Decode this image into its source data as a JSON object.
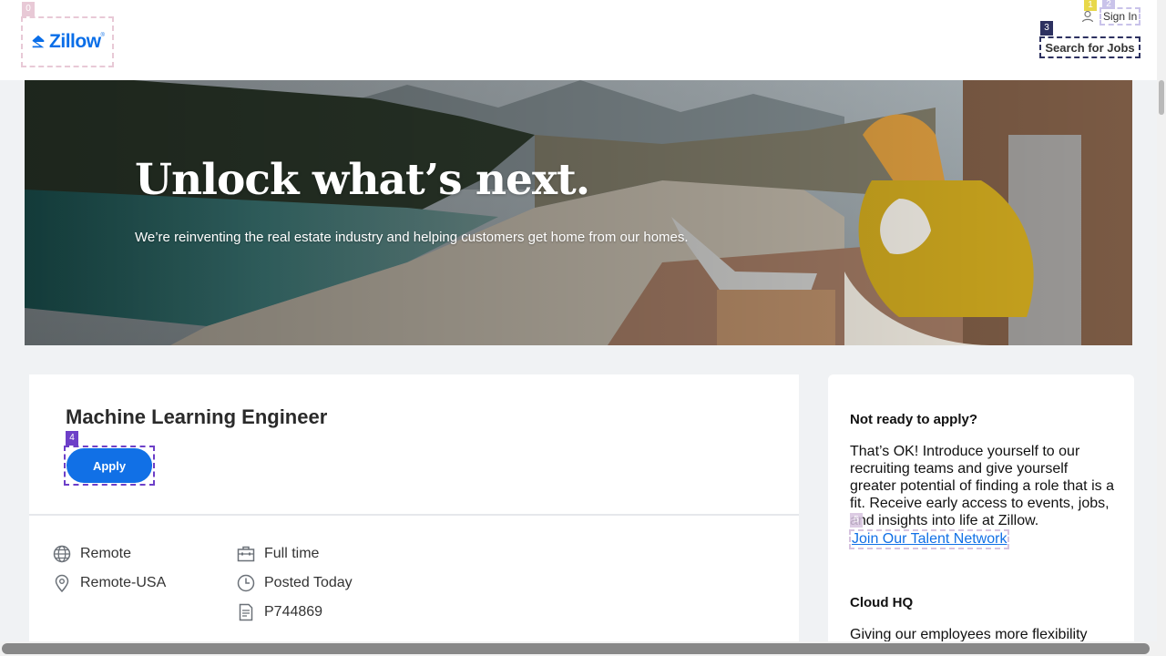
{
  "header": {
    "logo_text": "Zillow",
    "logo_reg": "®",
    "sign_in": "Sign In",
    "search_jobs": "Search for Jobs"
  },
  "tags": [
    "0",
    "1",
    "2",
    "3",
    "4",
    "5"
  ],
  "hero": {
    "title": "Unlock what’s next.",
    "subtitle": "We’re reinventing the real estate industry and helping customers get home from our homes."
  },
  "job": {
    "title": "Machine Learning Engineer",
    "apply_label": "Apply",
    "location_type": "Remote",
    "location": "Remote-USA",
    "employment_type": "Full time",
    "posted": "Posted Today",
    "req_id": "P744869"
  },
  "side": {
    "heading1": "Not ready to apply?",
    "body1": "That’s OK! Introduce yourself to our recruiting teams and give yourself greater potential of finding a role that is a fit. Receive early access to events, jobs, and insights into life at Zillow.",
    "talent_link": "Join Our Talent Network",
    "heading2": "Cloud HQ",
    "body2": "Giving our employees more flexibility"
  },
  "colors": {
    "brand": "#0a6ee8",
    "apply_button": "#1170e6",
    "page_bg": "#f0f2f4"
  }
}
